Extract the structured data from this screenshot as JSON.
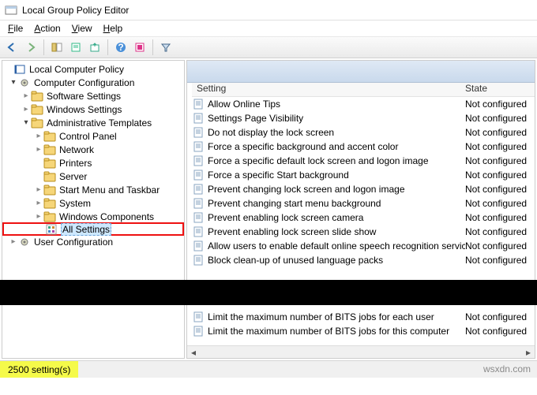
{
  "window": {
    "title": "Local Group Policy Editor"
  },
  "menu": {
    "file": "File",
    "action": "Action",
    "view": "View",
    "help": "Help"
  },
  "toolbar": {
    "back": "back",
    "forward": "forward",
    "up": "up",
    "show_hide_tree": "tree",
    "export": "export",
    "refresh": "refresh",
    "help": "help",
    "props": "props",
    "filter": "filter"
  },
  "tree": {
    "root": "Local Computer Policy",
    "computer_cfg": "Computer Configuration",
    "software": "Software Settings",
    "windows": "Windows Settings",
    "admin": "Administrative Templates",
    "control_panel": "Control Panel",
    "network": "Network",
    "printers": "Printers",
    "server": "Server",
    "start_menu": "Start Menu and Taskbar",
    "system": "System",
    "win_components": "Windows Components",
    "all_settings": "All Settings",
    "user_cfg": "User Configuration"
  },
  "columns": {
    "setting": "Setting",
    "state": "State"
  },
  "rows": [
    {
      "label": "Allow Online Tips",
      "state": "Not configured"
    },
    {
      "label": "Settings Page Visibility",
      "state": "Not configured"
    },
    {
      "label": "Do not display the lock screen",
      "state": "Not configured"
    },
    {
      "label": "Force a specific background and accent color",
      "state": "Not configured"
    },
    {
      "label": "Force a specific default lock screen and logon image",
      "state": "Not configured"
    },
    {
      "label": "Force a specific Start background",
      "state": "Not configured"
    },
    {
      "label": "Prevent changing lock screen and logon image",
      "state": "Not configured"
    },
    {
      "label": "Prevent changing start menu background",
      "state": "Not configured"
    },
    {
      "label": "Prevent enabling lock screen camera",
      "state": "Not configured"
    },
    {
      "label": "Prevent enabling lock screen slide show",
      "state": "Not configured"
    },
    {
      "label": "Allow users to enable default online speech recognition services",
      "state": "Not configured"
    },
    {
      "label": "Block clean-up of unused language packs",
      "state": "Not configured"
    }
  ],
  "rows_after_bar": [
    {
      "label": "Limit the maximum number of BITS jobs for each user",
      "state": "Not configured"
    },
    {
      "label": "Limit the maximum number of BITS jobs for this computer",
      "state": "Not configured"
    }
  ],
  "status": {
    "count": "2500 setting(s)"
  },
  "watermark": "wsxdn.com"
}
